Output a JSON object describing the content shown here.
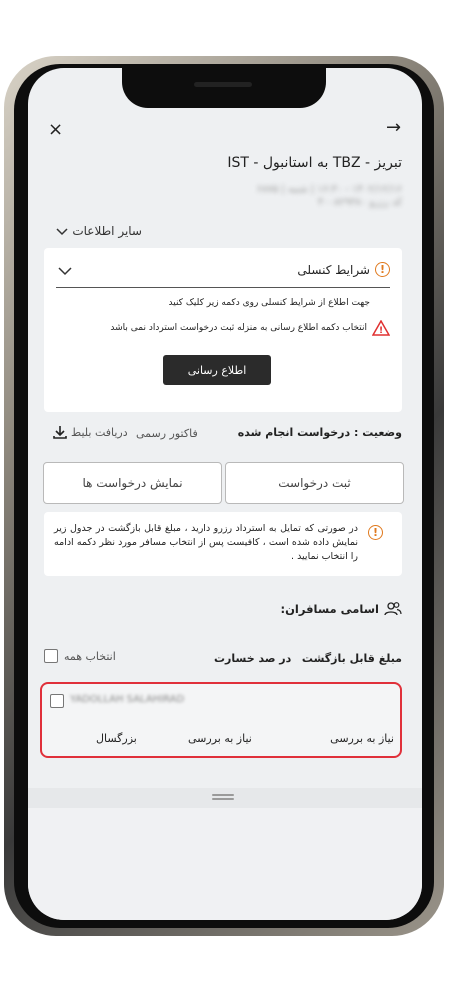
{
  "header": {
    "route_title": "تبریز - TBZ به استانبول - IST",
    "close_glyph": "×",
    "back_glyph": "→",
    "flight_detail_line1": "۱۴۰۲/۱۲/۱۶ - ۱۶:۳۰ | شنبه | ۶۸۷۵",
    "flight_detail_line2": "کد رزرو ۴۰۰۸۲۹۳۸۰"
  },
  "other_info": {
    "label": "سایر اطلاعات",
    "chevron": "⌄"
  },
  "cancel_card": {
    "title": "شرایط کنسلی",
    "info_text": "جهت اطلاع از شرایط کنسلی روی دکمه زیر کلیک کنید",
    "warning_text": "انتخاب دکمه اطلاع رسانی به منزله ثبت درخواست استرداد نمی باشد",
    "notify_button": "اطلاع رسانی"
  },
  "status": {
    "label": "وضعیت : درخواست انجام شده",
    "official_invoice": "فاکتور رسمی",
    "download_ticket": "دریافت بلیط"
  },
  "actions": {
    "submit_request": "ثبت درخواست",
    "show_requests": "نمایش درخواست ها"
  },
  "notice": {
    "text": "در صورتی که تمایل به استرداد رزرو دارید ، مبلغ قابل بازگشت در جدول زیر نمایش داده شده است ، کافیست پس از انتخاب مسافر مورد نظر دکمه ادامه را انتخاب نمایید ."
  },
  "passengers": {
    "title": "اسامی مسافران:",
    "columns": {
      "refund_amount": "مبلغ قابل بازگشت",
      "penalty_percent": "در صد خسارت",
      "select_all": "انتخاب همه"
    },
    "rows": [
      {
        "name": "YADOLLAH SALAHIRAD",
        "refund": "نیاز به بررسی",
        "penalty": "نیاز به بررسی",
        "age_type": "بزرگسال"
      }
    ]
  },
  "colors": {
    "accent_dark": "#2b2b2b",
    "warning_orange": "#e07a1f",
    "warning_red": "#e03030",
    "highlight_red": "#e0303a"
  }
}
